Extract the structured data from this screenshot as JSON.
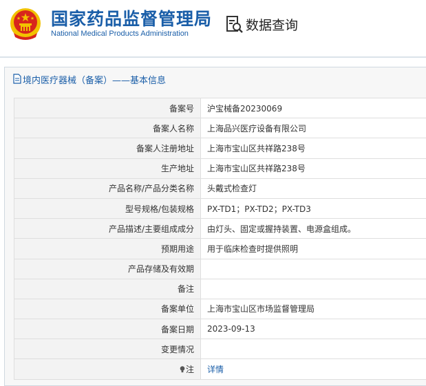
{
  "header": {
    "title_cn": "国家药品监督管理局",
    "title_en": "National Medical Products Administration",
    "query_label": "数据查询",
    "emblem_icon": "national-emblem-icon",
    "query_icon": "document-search-icon"
  },
  "panel": {
    "title": "境内医疗器械（备案）——基本信息",
    "title_icon": "document-icon"
  },
  "rows": [
    {
      "label": "备案号",
      "value": "沪宝械备20230069"
    },
    {
      "label": "备案人名称",
      "value": "上海品兴医疗设备有限公司"
    },
    {
      "label": "备案人注册地址",
      "value": "上海市宝山区共祥路238号"
    },
    {
      "label": "生产地址",
      "value": "上海市宝山区共祥路238号"
    },
    {
      "label": "产品名称/产品分类名称",
      "value": "头戴式检查灯"
    },
    {
      "label": "型号规格/包装规格",
      "value": "PX-TD1；PX-TD2；PX-TD3"
    },
    {
      "label": "产品描述/主要组成成分",
      "value": "由灯头、固定或握持装置、电源盒组成。"
    },
    {
      "label": "预期用途",
      "value": "用于临床检查时提供照明"
    },
    {
      "label": "产品存储及有效期",
      "value": ""
    },
    {
      "label": "备注",
      "value": ""
    },
    {
      "label": "备案单位",
      "value": "上海市宝山区市场监督管理局"
    },
    {
      "label": "备案日期",
      "value": "2023-09-13"
    },
    {
      "label": "变更情况",
      "value": ""
    },
    {
      "label": "注",
      "value": "详情"
    }
  ],
  "colors": {
    "brand_blue": "#1a5ea8",
    "emblem_red": "#d8261c",
    "emblem_gold": "#f2c200"
  }
}
